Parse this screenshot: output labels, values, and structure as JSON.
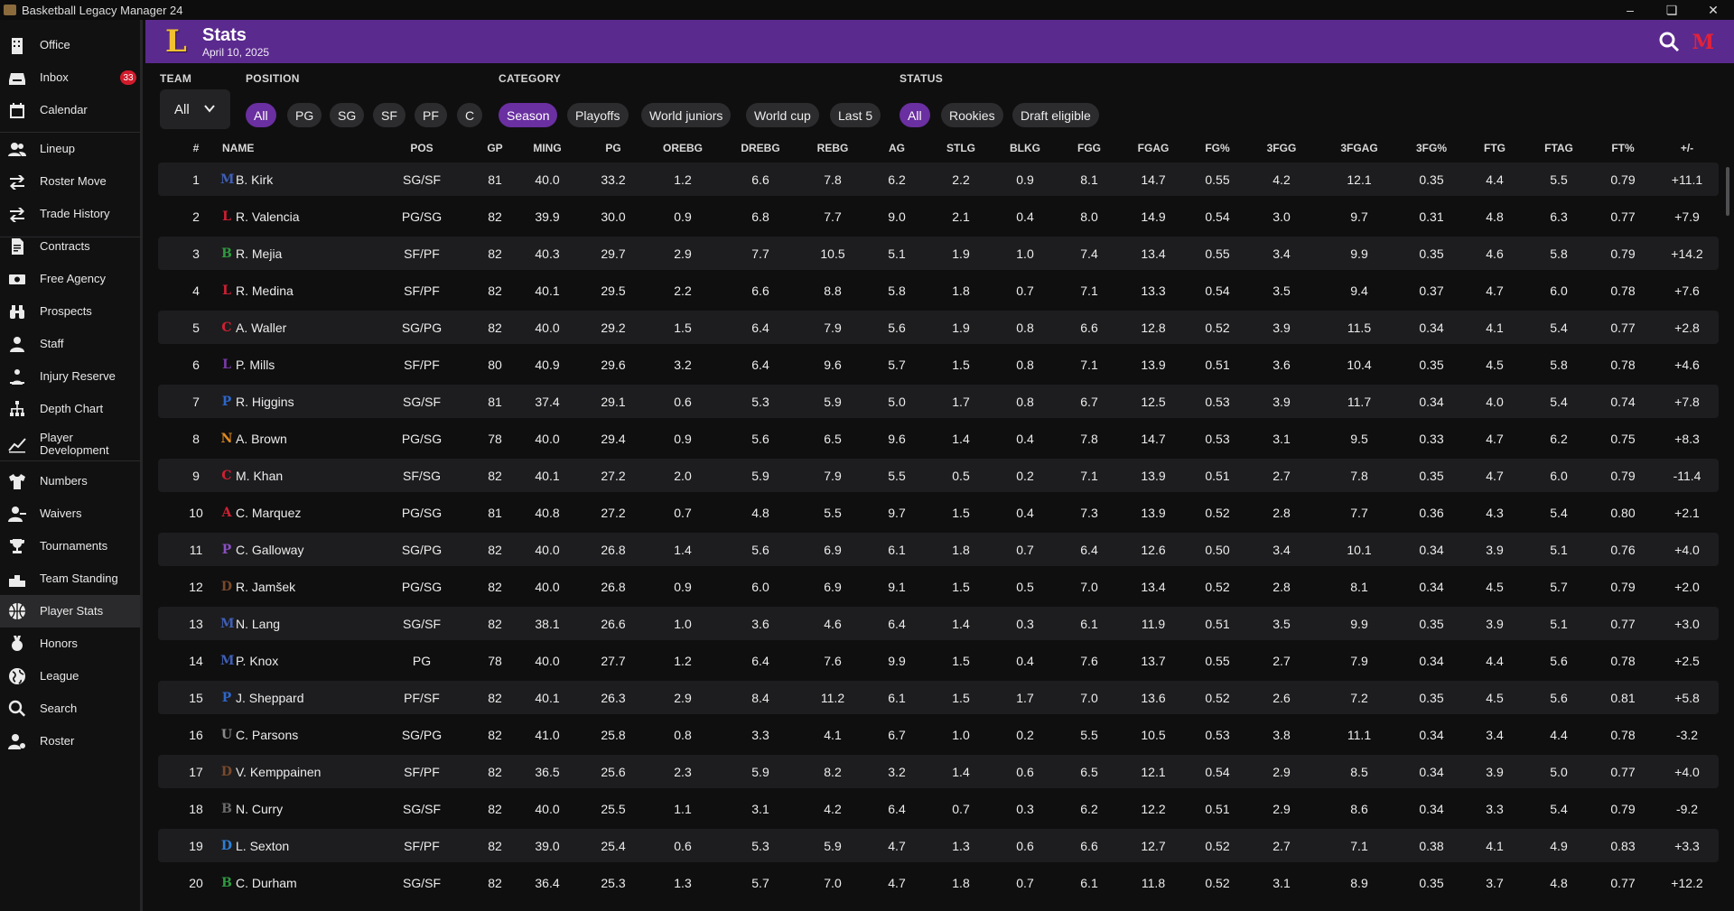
{
  "window": {
    "title": "Basketball Legacy Manager 24"
  },
  "sidebar": {
    "items": [
      {
        "label": "Office",
        "icon": "building-icon"
      },
      {
        "label": "Inbox",
        "icon": "inbox-icon",
        "badge": "33"
      },
      {
        "label": "Calendar",
        "icon": "calendar-icon"
      },
      {
        "label": "Lineup",
        "icon": "people-icon"
      },
      {
        "label": "Roster Move",
        "icon": "swap-icon"
      },
      {
        "label": "Trade History",
        "icon": "trade-icon"
      },
      {
        "label": "Contracts",
        "icon": "contract-icon"
      },
      {
        "label": "Free Agency",
        "icon": "money-icon"
      },
      {
        "label": "Prospects",
        "icon": "binoculars-icon"
      },
      {
        "label": "Staff",
        "icon": "staff-icon"
      },
      {
        "label": "Injury Reserve",
        "icon": "injury-icon"
      },
      {
        "label": "Depth Chart",
        "icon": "hierarchy-icon"
      },
      {
        "label": "Player Development",
        "icon": "trend-icon"
      },
      {
        "label": "Numbers",
        "icon": "shirt-icon"
      },
      {
        "label": "Waivers",
        "icon": "user-minus-icon"
      },
      {
        "label": "Tournaments",
        "icon": "trophy-icon"
      },
      {
        "label": "Team Standing",
        "icon": "podium-icon"
      },
      {
        "label": "Player Stats",
        "icon": "basketball-icon",
        "active": true
      },
      {
        "label": "Honors",
        "icon": "medal-icon"
      },
      {
        "label": "League",
        "icon": "globe-icon"
      },
      {
        "label": "Search",
        "icon": "search-icon"
      },
      {
        "label": "Roster",
        "icon": "user-settings-icon"
      }
    ]
  },
  "header": {
    "title": "Stats",
    "date": "April 10, 2025",
    "team_logo": "L",
    "league_logo": "M"
  },
  "filters": {
    "team_label": "TEAM",
    "team_value": "All",
    "position_label": "POSITION",
    "positions": [
      "All",
      "PG",
      "SG",
      "SF",
      "PF",
      "C"
    ],
    "position_selected": "All",
    "category_label": "CATEGORY",
    "categories": [
      "Season",
      "Playoffs",
      "World juniors",
      "World cup",
      "Last 5"
    ],
    "category_selected": "Season",
    "status_label": "STATUS",
    "statuses": [
      "All",
      "Rookies",
      "Draft eligible"
    ],
    "status_selected": "All"
  },
  "table": {
    "columns": [
      "#",
      "NAME",
      "POS",
      "GP",
      "MING",
      "PG",
      "OREBG",
      "DREBG",
      "REBG",
      "AG",
      "STLG",
      "BLKG",
      "FGG",
      "FGAG",
      "FG%",
      "3FGG",
      "3FGAG",
      "3FG%",
      "FTG",
      "FTAG",
      "FT%",
      "+/-"
    ],
    "rows": [
      {
        "rank": "1",
        "logo": "M",
        "logo_color": "#3f5fb6",
        "name": "B. Kirk",
        "pos": "SG/SF",
        "gp": "81",
        "ming": "40.0",
        "pg": "33.2",
        "orebg": "1.2",
        "drebg": "6.6",
        "rebg": "7.8",
        "ag": "6.2",
        "stlg": "2.2",
        "blkg": "0.9",
        "fgg": "8.1",
        "fgag": "14.7",
        "fgp": "0.55",
        "tfgg": "4.2",
        "tfgag": "12.1",
        "tfgp": "0.35",
        "ftg": "4.4",
        "ftag": "5.5",
        "ftp": "0.79",
        "pm": "+11.1"
      },
      {
        "rank": "2",
        "logo": "L",
        "logo_color": "#d02033",
        "name": "R. Valencia",
        "pos": "PG/SG",
        "gp": "82",
        "ming": "39.9",
        "pg": "30.0",
        "orebg": "0.9",
        "drebg": "6.8",
        "rebg": "7.7",
        "ag": "9.0",
        "stlg": "2.1",
        "blkg": "0.4",
        "fgg": "8.0",
        "fgag": "14.9",
        "fgp": "0.54",
        "tfgg": "3.0",
        "tfgag": "9.7",
        "tfgp": "0.31",
        "ftg": "4.8",
        "ftag": "6.3",
        "ftp": "0.77",
        "pm": "+7.9"
      },
      {
        "rank": "3",
        "logo": "B",
        "logo_color": "#2e9a3f",
        "name": "R. Mejia",
        "pos": "SF/PF",
        "gp": "82",
        "ming": "40.3",
        "pg": "29.7",
        "orebg": "2.9",
        "drebg": "7.7",
        "rebg": "10.5",
        "ag": "5.1",
        "stlg": "1.9",
        "blkg": "1.0",
        "fgg": "7.4",
        "fgag": "13.4",
        "fgp": "0.55",
        "tfgg": "3.4",
        "tfgag": "9.9",
        "tfgp": "0.35",
        "ftg": "4.6",
        "ftag": "5.8",
        "ftp": "0.79",
        "pm": "+14.2"
      },
      {
        "rank": "4",
        "logo": "L",
        "logo_color": "#d02033",
        "name": "R. Medina",
        "pos": "SF/PF",
        "gp": "82",
        "ming": "40.1",
        "pg": "29.5",
        "orebg": "2.2",
        "drebg": "6.6",
        "rebg": "8.8",
        "ag": "5.8",
        "stlg": "1.8",
        "blkg": "0.7",
        "fgg": "7.1",
        "fgag": "13.3",
        "fgp": "0.54",
        "tfgg": "3.5",
        "tfgag": "9.4",
        "tfgp": "0.37",
        "ftg": "4.7",
        "ftag": "6.0",
        "ftp": "0.78",
        "pm": "+7.6"
      },
      {
        "rank": "5",
        "logo": "C",
        "logo_color": "#d02033",
        "name": "A. Waller",
        "pos": "SG/PG",
        "gp": "82",
        "ming": "40.0",
        "pg": "29.2",
        "orebg": "1.5",
        "drebg": "6.4",
        "rebg": "7.9",
        "ag": "5.6",
        "stlg": "1.9",
        "blkg": "0.8",
        "fgg": "6.6",
        "fgag": "12.8",
        "fgp": "0.52",
        "tfgg": "3.9",
        "tfgag": "11.5",
        "tfgp": "0.34",
        "ftg": "4.1",
        "ftag": "5.4",
        "ftp": "0.77",
        "pm": "+2.8"
      },
      {
        "rank": "6",
        "logo": "L",
        "logo_color": "#7a3aa8",
        "name": "P. Mills",
        "pos": "SF/PF",
        "gp": "80",
        "ming": "40.9",
        "pg": "29.6",
        "orebg": "3.2",
        "drebg": "6.4",
        "rebg": "9.6",
        "ag": "5.7",
        "stlg": "1.5",
        "blkg": "0.8",
        "fgg": "7.1",
        "fgag": "13.9",
        "fgp": "0.51",
        "tfgg": "3.6",
        "tfgag": "10.4",
        "tfgp": "0.35",
        "ftg": "4.5",
        "ftag": "5.8",
        "ftp": "0.78",
        "pm": "+4.6"
      },
      {
        "rank": "7",
        "logo": "P",
        "logo_color": "#2e66c9",
        "name": "R. Higgins",
        "pos": "SG/SF",
        "gp": "81",
        "ming": "37.4",
        "pg": "29.1",
        "orebg": "0.6",
        "drebg": "5.3",
        "rebg": "5.9",
        "ag": "5.0",
        "stlg": "1.7",
        "blkg": "0.8",
        "fgg": "6.7",
        "fgag": "12.5",
        "fgp": "0.53",
        "tfgg": "3.9",
        "tfgag": "11.7",
        "tfgp": "0.34",
        "ftg": "4.0",
        "ftag": "5.4",
        "ftp": "0.74",
        "pm": "+7.8"
      },
      {
        "rank": "8",
        "logo": "N",
        "logo_color": "#e08a1e",
        "name": "A. Brown",
        "pos": "PG/SG",
        "gp": "78",
        "ming": "40.0",
        "pg": "29.4",
        "orebg": "0.9",
        "drebg": "5.6",
        "rebg": "6.5",
        "ag": "9.6",
        "stlg": "1.4",
        "blkg": "0.4",
        "fgg": "7.8",
        "fgag": "14.7",
        "fgp": "0.53",
        "tfgg": "3.1",
        "tfgag": "9.5",
        "tfgp": "0.33",
        "ftg": "4.7",
        "ftag": "6.2",
        "ftp": "0.75",
        "pm": "+8.3"
      },
      {
        "rank": "9",
        "logo": "C",
        "logo_color": "#d02033",
        "name": "M. Khan",
        "pos": "SF/SG",
        "gp": "82",
        "ming": "40.1",
        "pg": "27.2",
        "orebg": "2.0",
        "drebg": "5.9",
        "rebg": "7.9",
        "ag": "5.5",
        "stlg": "0.5",
        "blkg": "0.2",
        "fgg": "7.1",
        "fgag": "13.9",
        "fgp": "0.51",
        "tfgg": "2.7",
        "tfgag": "7.8",
        "tfgp": "0.35",
        "ftg": "4.7",
        "ftag": "6.0",
        "ftp": "0.79",
        "pm": "-11.4"
      },
      {
        "rank": "10",
        "logo": "A",
        "logo_color": "#d02033",
        "name": "C. Marquez",
        "pos": "PG/SG",
        "gp": "81",
        "ming": "40.8",
        "pg": "27.2",
        "orebg": "0.7",
        "drebg": "4.8",
        "rebg": "5.5",
        "ag": "9.7",
        "stlg": "1.5",
        "blkg": "0.4",
        "fgg": "7.3",
        "fgag": "13.9",
        "fgp": "0.52",
        "tfgg": "2.8",
        "tfgag": "7.7",
        "tfgp": "0.36",
        "ftg": "4.3",
        "ftag": "5.4",
        "ftp": "0.80",
        "pm": "+2.1"
      },
      {
        "rank": "11",
        "logo": "P",
        "logo_color": "#8a4fc0",
        "name": "C. Galloway",
        "pos": "SG/PG",
        "gp": "82",
        "ming": "40.0",
        "pg": "26.8",
        "orebg": "1.4",
        "drebg": "5.6",
        "rebg": "6.9",
        "ag": "6.1",
        "stlg": "1.8",
        "blkg": "0.7",
        "fgg": "6.4",
        "fgag": "12.6",
        "fgp": "0.50",
        "tfgg": "3.4",
        "tfgag": "10.1",
        "tfgp": "0.34",
        "ftg": "3.9",
        "ftag": "5.1",
        "ftp": "0.76",
        "pm": "+4.0"
      },
      {
        "rank": "12",
        "logo": "D",
        "logo_color": "#7a4a2a",
        "name": "R. Jamšek",
        "pos": "PG/SG",
        "gp": "82",
        "ming": "40.0",
        "pg": "26.8",
        "orebg": "0.9",
        "drebg": "6.0",
        "rebg": "6.9",
        "ag": "9.1",
        "stlg": "1.5",
        "blkg": "0.5",
        "fgg": "7.0",
        "fgag": "13.4",
        "fgp": "0.52",
        "tfgg": "2.8",
        "tfgag": "8.1",
        "tfgp": "0.34",
        "ftg": "4.5",
        "ftag": "5.7",
        "ftp": "0.79",
        "pm": "+2.0"
      },
      {
        "rank": "13",
        "logo": "M",
        "logo_color": "#3f5fb6",
        "name": "N. Lang",
        "pos": "SG/SF",
        "gp": "82",
        "ming": "38.1",
        "pg": "26.6",
        "orebg": "1.0",
        "drebg": "3.6",
        "rebg": "4.6",
        "ag": "6.4",
        "stlg": "1.4",
        "blkg": "0.3",
        "fgg": "6.1",
        "fgag": "11.9",
        "fgp": "0.51",
        "tfgg": "3.5",
        "tfgag": "9.9",
        "tfgp": "0.35",
        "ftg": "3.9",
        "ftag": "5.1",
        "ftp": "0.77",
        "pm": "+3.0"
      },
      {
        "rank": "14",
        "logo": "M",
        "logo_color": "#3f5fb6",
        "name": "P. Knox",
        "pos": "PG",
        "gp": "78",
        "ming": "40.0",
        "pg": "27.7",
        "orebg": "1.2",
        "drebg": "6.4",
        "rebg": "7.6",
        "ag": "9.9",
        "stlg": "1.5",
        "blkg": "0.4",
        "fgg": "7.6",
        "fgag": "13.7",
        "fgp": "0.55",
        "tfgg": "2.7",
        "tfgag": "7.9",
        "tfgp": "0.34",
        "ftg": "4.4",
        "ftag": "5.6",
        "ftp": "0.78",
        "pm": "+2.5"
      },
      {
        "rank": "15",
        "logo": "P",
        "logo_color": "#2e66c9",
        "name": "J. Sheppard",
        "pos": "PF/SF",
        "gp": "82",
        "ming": "40.1",
        "pg": "26.3",
        "orebg": "2.9",
        "drebg": "8.4",
        "rebg": "11.2",
        "ag": "6.1",
        "stlg": "1.5",
        "blkg": "1.7",
        "fgg": "7.0",
        "fgag": "13.6",
        "fgp": "0.52",
        "tfgg": "2.6",
        "tfgag": "7.2",
        "tfgp": "0.35",
        "ftg": "4.5",
        "ftag": "5.6",
        "ftp": "0.81",
        "pm": "+5.8"
      },
      {
        "rank": "16",
        "logo": "U",
        "logo_color": "#8a8a8a",
        "name": "C. Parsons",
        "pos": "SG/PG",
        "gp": "82",
        "ming": "41.0",
        "pg": "25.8",
        "orebg": "0.8",
        "drebg": "3.3",
        "rebg": "4.1",
        "ag": "6.7",
        "stlg": "1.0",
        "blkg": "0.2",
        "fgg": "5.5",
        "fgag": "10.5",
        "fgp": "0.53",
        "tfgg": "3.8",
        "tfgag": "11.1",
        "tfgp": "0.34",
        "ftg": "3.4",
        "ftag": "4.4",
        "ftp": "0.78",
        "pm": "-3.2"
      },
      {
        "rank": "17",
        "logo": "D",
        "logo_color": "#7a4a2a",
        "name": "V. Kemppainen",
        "pos": "SF/PF",
        "gp": "82",
        "ming": "36.5",
        "pg": "25.6",
        "orebg": "2.3",
        "drebg": "5.9",
        "rebg": "8.2",
        "ag": "3.2",
        "stlg": "1.4",
        "blkg": "0.6",
        "fgg": "6.5",
        "fgag": "12.1",
        "fgp": "0.54",
        "tfgg": "2.9",
        "tfgag": "8.5",
        "tfgp": "0.34",
        "ftg": "3.9",
        "ftag": "5.0",
        "ftp": "0.77",
        "pm": "+4.0"
      },
      {
        "rank": "18",
        "logo": "B",
        "logo_color": "#6a6a6a",
        "name": "N. Curry",
        "pos": "SG/SF",
        "gp": "82",
        "ming": "40.0",
        "pg": "25.5",
        "orebg": "1.1",
        "drebg": "3.1",
        "rebg": "4.2",
        "ag": "6.4",
        "stlg": "0.7",
        "blkg": "0.3",
        "fgg": "6.2",
        "fgag": "12.2",
        "fgp": "0.51",
        "tfgg": "2.9",
        "tfgag": "8.6",
        "tfgp": "0.34",
        "ftg": "3.3",
        "ftag": "5.4",
        "ftp": "0.79",
        "pm": "-9.2"
      },
      {
        "rank": "19",
        "logo": "D",
        "logo_color": "#2e7fd6",
        "name": "L. Sexton",
        "pos": "SF/PF",
        "gp": "82",
        "ming": "39.0",
        "pg": "25.4",
        "orebg": "0.6",
        "drebg": "5.3",
        "rebg": "5.9",
        "ag": "4.7",
        "stlg": "1.3",
        "blkg": "0.6",
        "fgg": "6.6",
        "fgag": "12.7",
        "fgp": "0.52",
        "tfgg": "2.7",
        "tfgag": "7.1",
        "tfgp": "0.38",
        "ftg": "4.1",
        "ftag": "4.9",
        "ftp": "0.83",
        "pm": "+3.3"
      },
      {
        "rank": "20",
        "logo": "B",
        "logo_color": "#2e9a3f",
        "name": "C. Durham",
        "pos": "SG/SF",
        "gp": "82",
        "ming": "36.4",
        "pg": "25.3",
        "orebg": "1.3",
        "drebg": "5.7",
        "rebg": "7.0",
        "ag": "4.7",
        "stlg": "1.8",
        "blkg": "0.7",
        "fgg": "6.1",
        "fgag": "11.8",
        "fgp": "0.52",
        "tfgg": "3.1",
        "tfgag": "8.9",
        "tfgp": "0.35",
        "ftg": "3.7",
        "ftag": "4.8",
        "ftp": "0.77",
        "pm": "+12.2"
      }
    ]
  }
}
